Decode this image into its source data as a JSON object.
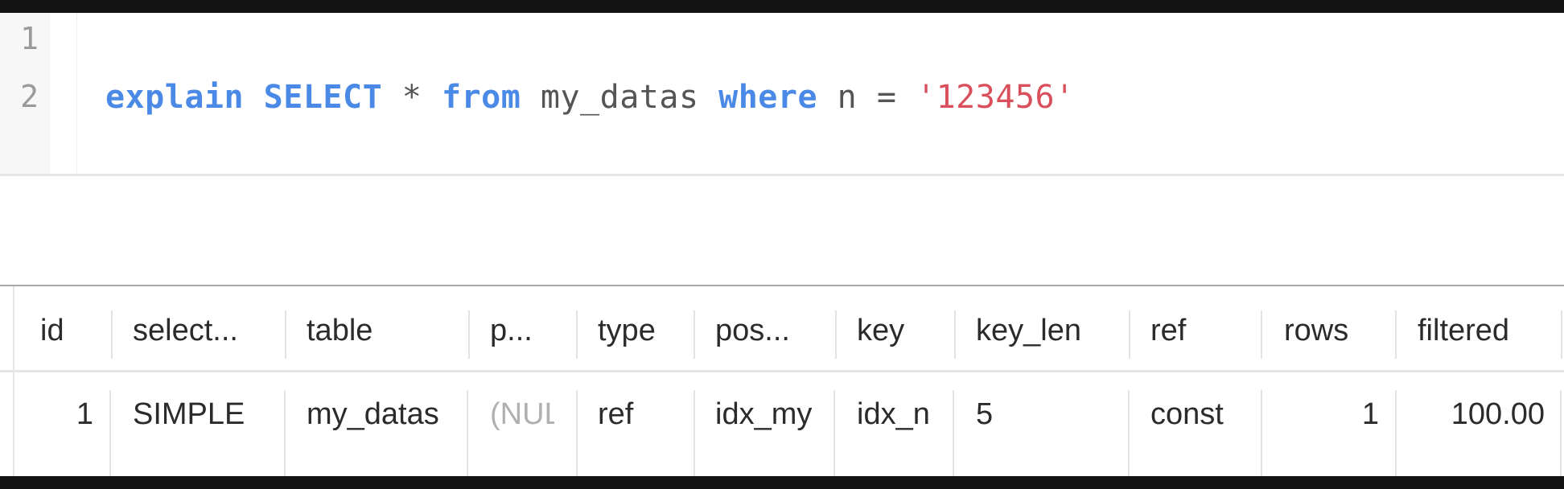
{
  "editor": {
    "line_numbers": [
      "1",
      "2"
    ],
    "line1": "",
    "line2_tokens": {
      "kw_explain": "explain",
      "kw_select": "SELECT",
      "star": "*",
      "kw_from": "from",
      "table": "my_datas",
      "kw_where": "where",
      "column": "n",
      "op": "=",
      "literal": "'123456'"
    }
  },
  "colors": {
    "keyword": "#4a8ae6",
    "string": "#d9505c",
    "identifier": "#555555",
    "null_text": "#b0b0b0"
  },
  "results": {
    "columns": [
      "id",
      "select...",
      "table",
      "p...",
      "type",
      "pos...",
      "key",
      "key_len",
      "ref",
      "rows",
      "filtered"
    ],
    "rows": [
      {
        "id": "1",
        "select_type": "SIMPLE",
        "table": "my_datas",
        "partitions": "(NULL)",
        "type": "ref",
        "possible_keys": "idx_my",
        "key": "idx_n",
        "key_len": "5",
        "ref": "const",
        "rows": "1",
        "filtered": "100.00"
      }
    ]
  }
}
